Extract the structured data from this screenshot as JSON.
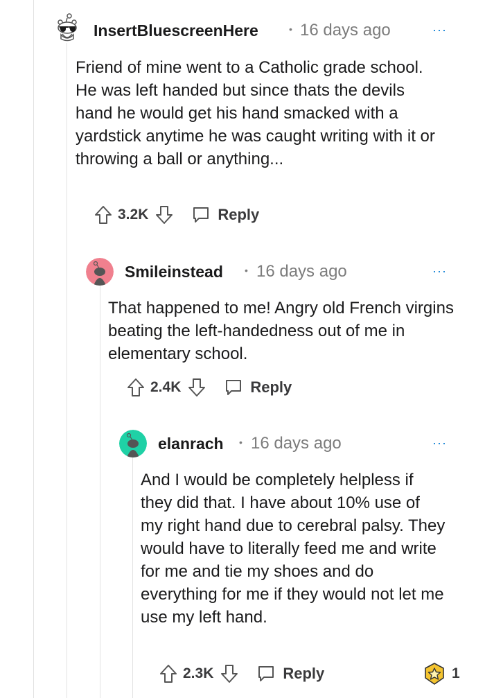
{
  "comments": [
    {
      "username": "InsertBluescreenHere",
      "time": "16 days ago",
      "more": "···",
      "body": "Friend of mine went to a Catholic grade school. He was left handed but since thats the devils hand he would get his hand smacked with a yardstick anytime he was caught writing with it or throwing a ball or anything...",
      "score": "3.2K",
      "reply_label": "Reply",
      "avatar_icon": "snoo-sunglasses-avatar"
    },
    {
      "username": "Smileinstead",
      "time": "16 days ago",
      "more": "···",
      "body": "That happened to me! Angry old French virgins beating the left-handedness out of me in elementary school.",
      "score": "2.4K",
      "reply_label": "Reply",
      "avatar_icon": "snoo-pink-avatar",
      "avatar_color": "#f0808e"
    },
    {
      "username": "elanrach",
      "time": "16 days ago",
      "more": "···",
      "body": "And I would be completely helpless if they did that. I have about 10% use of my right hand due to cerebral palsy. They would have to literally feed me and write for me and tie my shoes and do everything for me if they would not let me use my left hand.",
      "score": "2.3K",
      "reply_label": "Reply",
      "avatar_icon": "snoo-teal-avatar",
      "avatar_color": "#1fd1a6",
      "award_count": "1",
      "award_icon": "star-award-icon"
    }
  ]
}
